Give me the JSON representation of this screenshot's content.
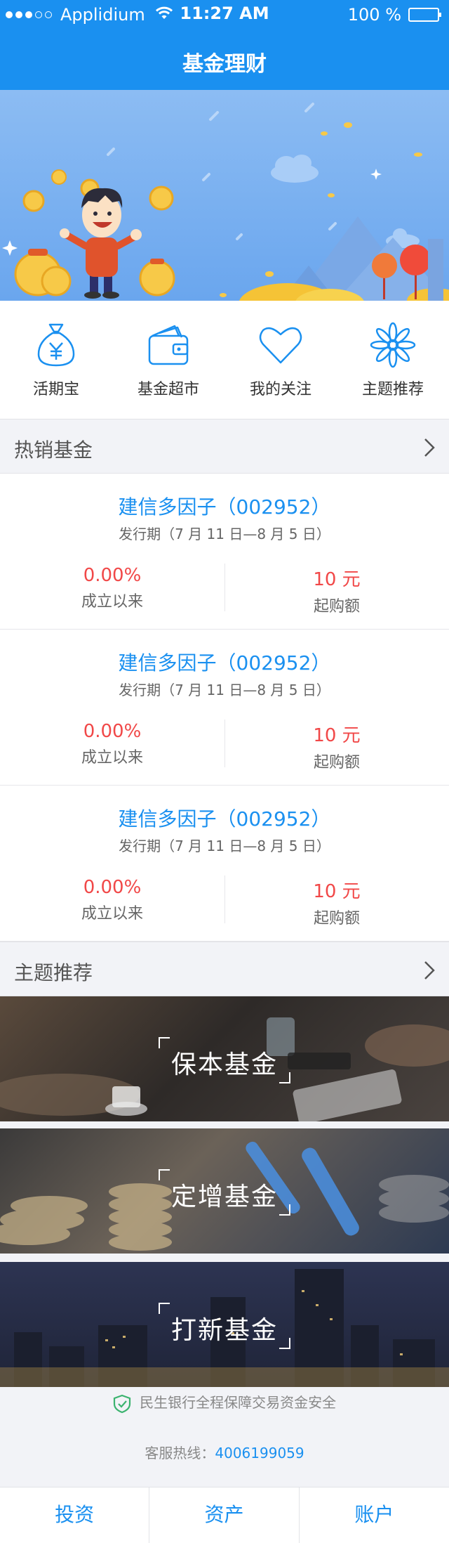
{
  "status_bar": {
    "carrier": "Applidium",
    "time": "11:27 AM",
    "battery": "100 %"
  },
  "header": {
    "title": "基金理财"
  },
  "quick_menu": [
    {
      "label": "活期宝",
      "icon": "money-bag-icon"
    },
    {
      "label": "基金超市",
      "icon": "wallet-icon"
    },
    {
      "label": "我的关注",
      "icon": "heart-icon"
    },
    {
      "label": "主题推荐",
      "icon": "flower-icon"
    }
  ],
  "hot_funds": {
    "title": "热销基金",
    "items": [
      {
        "name": "建信多因子（002952）",
        "period": "发行期（7 月 11 日—8 月 5 日）",
        "return_value": "0.00%",
        "return_label": "成立以来",
        "min_value": "10 元",
        "min_label": "起购额"
      },
      {
        "name": "建信多因子（002952）",
        "period": "发行期（7 月 11 日—8 月 5 日）",
        "return_value": "0.00%",
        "return_label": "成立以来",
        "min_value": "10 元",
        "min_label": "起购额"
      },
      {
        "name": "建信多因子（002952）",
        "period": "发行期（7 月 11 日—8 月 5 日）",
        "return_value": "0.00%",
        "return_label": "成立以来",
        "min_value": "10 元",
        "min_label": "起购额"
      }
    ]
  },
  "themes": {
    "title": "主题推荐",
    "items": [
      {
        "label": "保本基金"
      },
      {
        "label": "定增基金"
      },
      {
        "label": "打新基金"
      }
    ]
  },
  "footer": {
    "safety_text": "民生银行全程保障交易资金安全",
    "hotline_label": "客服热线：",
    "hotline_number": "4006199059"
  },
  "tabs": [
    {
      "label": "投资"
    },
    {
      "label": "资产"
    },
    {
      "label": "账户"
    }
  ],
  "colors": {
    "brand": "#1a90f0",
    "highlight": "#f14848"
  }
}
